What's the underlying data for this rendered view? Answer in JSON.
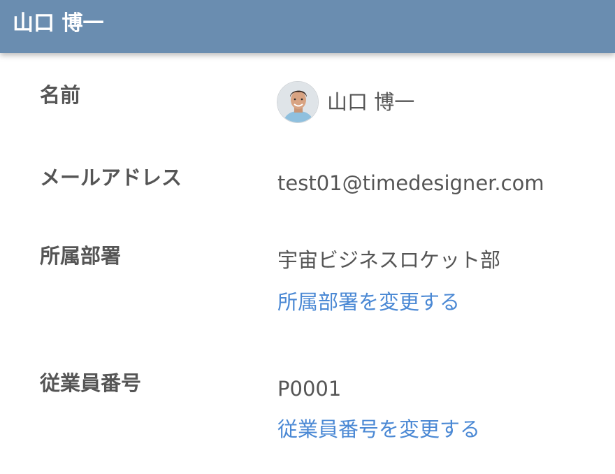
{
  "header": {
    "title": "山口 博一"
  },
  "profile": {
    "name": {
      "label": "名前",
      "value": "山口 博一",
      "avatar_icon": "user-photo"
    },
    "email": {
      "label": "メールアドレス",
      "value": "test01@timedesigner.com"
    },
    "department": {
      "label": "所属部署",
      "value": "宇宙ビジネスロケット部",
      "change_link": "所属部署を変更する"
    },
    "employee_number": {
      "label": "従業員番号",
      "value": "P0001",
      "change_link": "従業員番号を変更する"
    }
  },
  "colors": {
    "header_bg": "#6a8db0",
    "text": "#555555",
    "link": "#4a88d4"
  }
}
